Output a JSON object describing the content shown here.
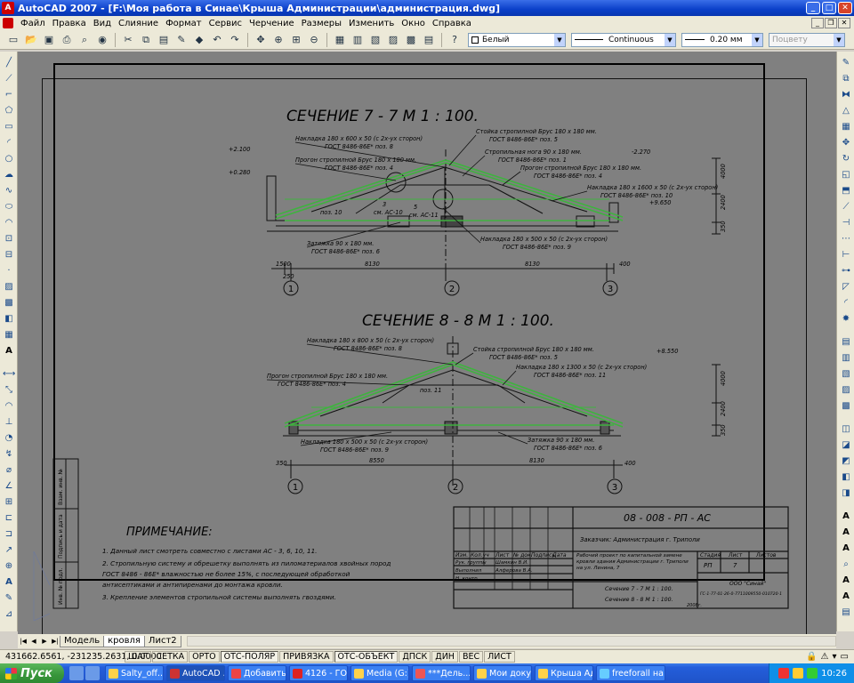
{
  "window": {
    "title": "AutoCAD 2007 - [F:\\Моя работа в Синае\\Крыша Администрации\\администрация.dwg]"
  },
  "menu": [
    "Файл",
    "Правка",
    "Вид",
    "Слияние",
    "Формат",
    "Сервис",
    "Черчение",
    "Размеры",
    "Изменить",
    "Окно",
    "Справка"
  ],
  "props": {
    "color": "Белый",
    "linetype": "Continuous",
    "lineweight": "0.20 мм",
    "plotstyle": "Поцвету"
  },
  "drawing": {
    "sec1_title": "СЕЧЕНИЕ  7 - 7  М 1 : 100.",
    "sec2_title": "СЕЧЕНИЕ  8 - 8  М 1 : 100.",
    "s1": {
      "l1a": "Накладка  180 х 600 х 50  (с 2х-ух сторон)",
      "l1b": "ГОСТ  8486-86Е*   поз. 8",
      "l2a": "Стойка стропилной  Брус  180 х 180 мм.",
      "l2b": "ГОСТ 8486-86Е*   поз. 5",
      "l3a": "Стропильная нога  90 х 180 мм.",
      "l3b": "ГОСТ 8486-86Е*   поз. 1",
      "l4a": "Прогон стропилной  Брус  180 х 180 мм.",
      "l4b": "ГОСТ 8486-86Е*   поз. 4",
      "l5a": "Прогон стропилной  Брус  180 х 180 мм.",
      "l5b": "ГОСТ 8486-86Е*   поз. 4",
      "l6a": "Накладка  180 х 1600 х 50  (с 2х-ух сторон)",
      "l6b": "ГОСТ 8486-86Е*   поз. 10",
      "l7a": "Затяжка  90 х 180 мм.",
      "l7b": "ГОСТ 8486-86Е*   поз. 6",
      "l8a": "Накладка  180 х 500 х 50  (с 2х-ух сторон)",
      "l8b": "ГОСТ 8486-86Е*   поз. 9",
      "m1": "поз. 10",
      "m2": "3",
      "m3": "см. АС-10",
      "m4": "5",
      "m5": "см. АС-11",
      "lvl1": "+2.100",
      "lvl2": "+0.280",
      "lvl3": "-2.270",
      "lvl4": "+9.650",
      "vd1": "4000",
      "vd2": "2400",
      "vd3": "350",
      "d1": "1500",
      "d2": "8130",
      "d3": "8130",
      "d4": "400",
      "d5": "250",
      "ax1": "1",
      "ax2": "2",
      "ax3": "3"
    },
    "s2": {
      "l1a": "Накладка  180 х 800 х 50  (с 2х-ух сторон)",
      "l1b": "ГОСТ  8486-86Е*   поз. 8",
      "l2a": "Стойка стропилной  Брус  180 х 180 мм.",
      "l2b": "ГОСТ 8486-86Е*   поз. 5",
      "l3a": "Прогон стропилной  Брус  180 х 180 мм.",
      "l3b": "ГОСТ 8486-86Е*   поз. 4",
      "l4a": "Накладка  180 х 1300 х 50  (с 2х-ух сторон)",
      "l4b": "ГОСТ 8486-86Е*   поз. 11",
      "l5a": "Накладка  180 х 500 х 50  (с 2х-ух сторон)",
      "l5b": "ГОСТ 8486-86Е*   поз. 9",
      "l6a": "Затяжка  90 х 180 мм.",
      "l6b": "ГОСТ 8486-86Е*   поз. 6",
      "m1": "поз. 11",
      "lvl1": "+8.550",
      "lvl2": "-2.270",
      "vd1": "4000",
      "vd2": "2400",
      "vd3": "350",
      "d1": "350",
      "d2": "8550",
      "d3": "8130",
      "d4": "400",
      "ax1": "1",
      "ax2": "2",
      "ax3": "3"
    },
    "notes": {
      "title": "ПРИМЕЧАНИЕ:",
      "n1": "1. Данный лист смотреть совместно с листами  АС - 3, 6, 10, 11.",
      "n2": "2. Стропильную систему и обрешетку выполнять из пиломатериалов хвойных пород",
      "n2b": "    ГОСТ 8486 - 86Е* влажностью не более 15%, с последующей обработкой",
      "n2c": "    антисептиками и антипиренами до монтажа кровли.",
      "n3": "3. Крепление элементов стропильной системы выполнять  гвоздями."
    },
    "stamp": {
      "code": "08 - 008 - РП - АС",
      "customer": "Заказчик: Администрация г. Триполи",
      "h1": "Изм.",
      "h2": "Кол.уч",
      "h3": "Лист",
      "h4": "№ док.",
      "h5": "Подпись",
      "h6": "Дата",
      "r1a": "Рук. группы",
      "r1b": "Шамкин В.И.",
      "r2a": "Выполнил",
      "r2b": "Алферова В.А.",
      "r3a": "Н. контр.",
      "project": "Рабочий проект по капитальной замене кровли здания Администрации г. Триполи на ул. Ленина, 7",
      "stage_h": "Стадия",
      "sheet_h": "Лист",
      "sheets_h": "Листов",
      "stage": "РП",
      "sheet": "7",
      "sub1": "Сечение  7 - 7  М 1 : 100.",
      "sub2": "Сечение  8 - 8  М 1 : 100.",
      "org": "ООО \"Синай\"",
      "orgcode": "ГС-1-77-01-26-0-7711009550-010720-1",
      "fmt": "2008г.",
      "side1": "Взам. инв. №",
      "side2": "Подпись и дата",
      "side3": "Инв. № подл."
    }
  },
  "tabs": [
    "Модель",
    "кровля",
    "Лист2"
  ],
  "status": {
    "coords": "431662.6561, -231235.2631, 0.0000",
    "buttons": [
      "ШАГ",
      "СЕТКА",
      "ОРТО",
      "ОТС-ПОЛЯР",
      "ПРИВЯЗКА",
      "ОТС-ОБЪЕКТ",
      "ДПСК",
      "ДИН",
      "ВЕС",
      "ЛИСТ"
    ]
  },
  "taskbar": {
    "start": "Пуск",
    "tasks": [
      "Salty_off....",
      "AutoCAD ...",
      "Добавить ...",
      "4126 - ГО...",
      "Media (G:)",
      "***Дель...",
      "Мои доку...",
      "Крыша Ад...",
      "freeforall на Server"
    ],
    "clock": "10:26"
  }
}
